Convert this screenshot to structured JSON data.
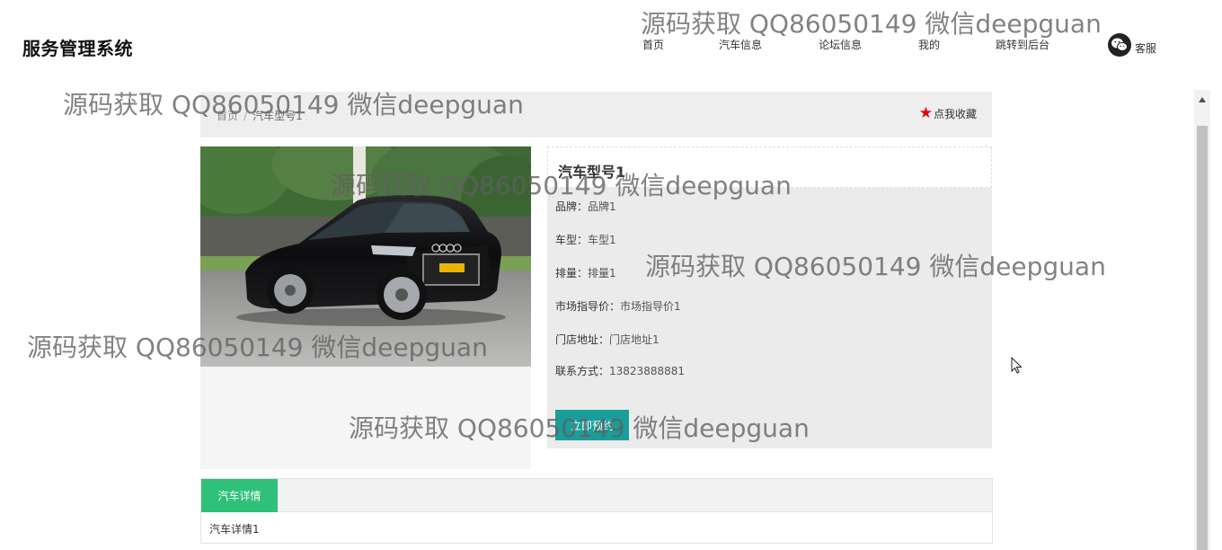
{
  "site": {
    "title": "服务管理系统"
  },
  "nav": {
    "items": [
      "首页",
      "汽车信息",
      "论坛信息",
      "我的",
      "跳转到后台"
    ],
    "service_label": "客服"
  },
  "breadcrumb": {
    "home": "首页",
    "separator": "/",
    "current": "汽车型号1"
  },
  "favorite": {
    "label": "点我收藏"
  },
  "car": {
    "title": "汽车型号1",
    "fields": [
      {
        "key": "品牌：",
        "value": "品牌1"
      },
      {
        "key": "车型：",
        "value": "车型1"
      },
      {
        "key": "排量：",
        "value": "排量1"
      },
      {
        "key": "市场指导价：",
        "value": "市场指导价1"
      },
      {
        "key": "门店地址：",
        "value": "门店地址1"
      },
      {
        "key": "联系方式：",
        "value": "13823888881"
      }
    ],
    "action_label": "立即预约"
  },
  "detail": {
    "tab_label": "汽车详情",
    "content": "汽车详情1"
  },
  "watermark": "源码获取 QQ86050149 微信deepguan",
  "colors": {
    "accent_teal": "#1a9e9a",
    "tab_green": "#2fc07a",
    "star_red": "#e60000"
  }
}
